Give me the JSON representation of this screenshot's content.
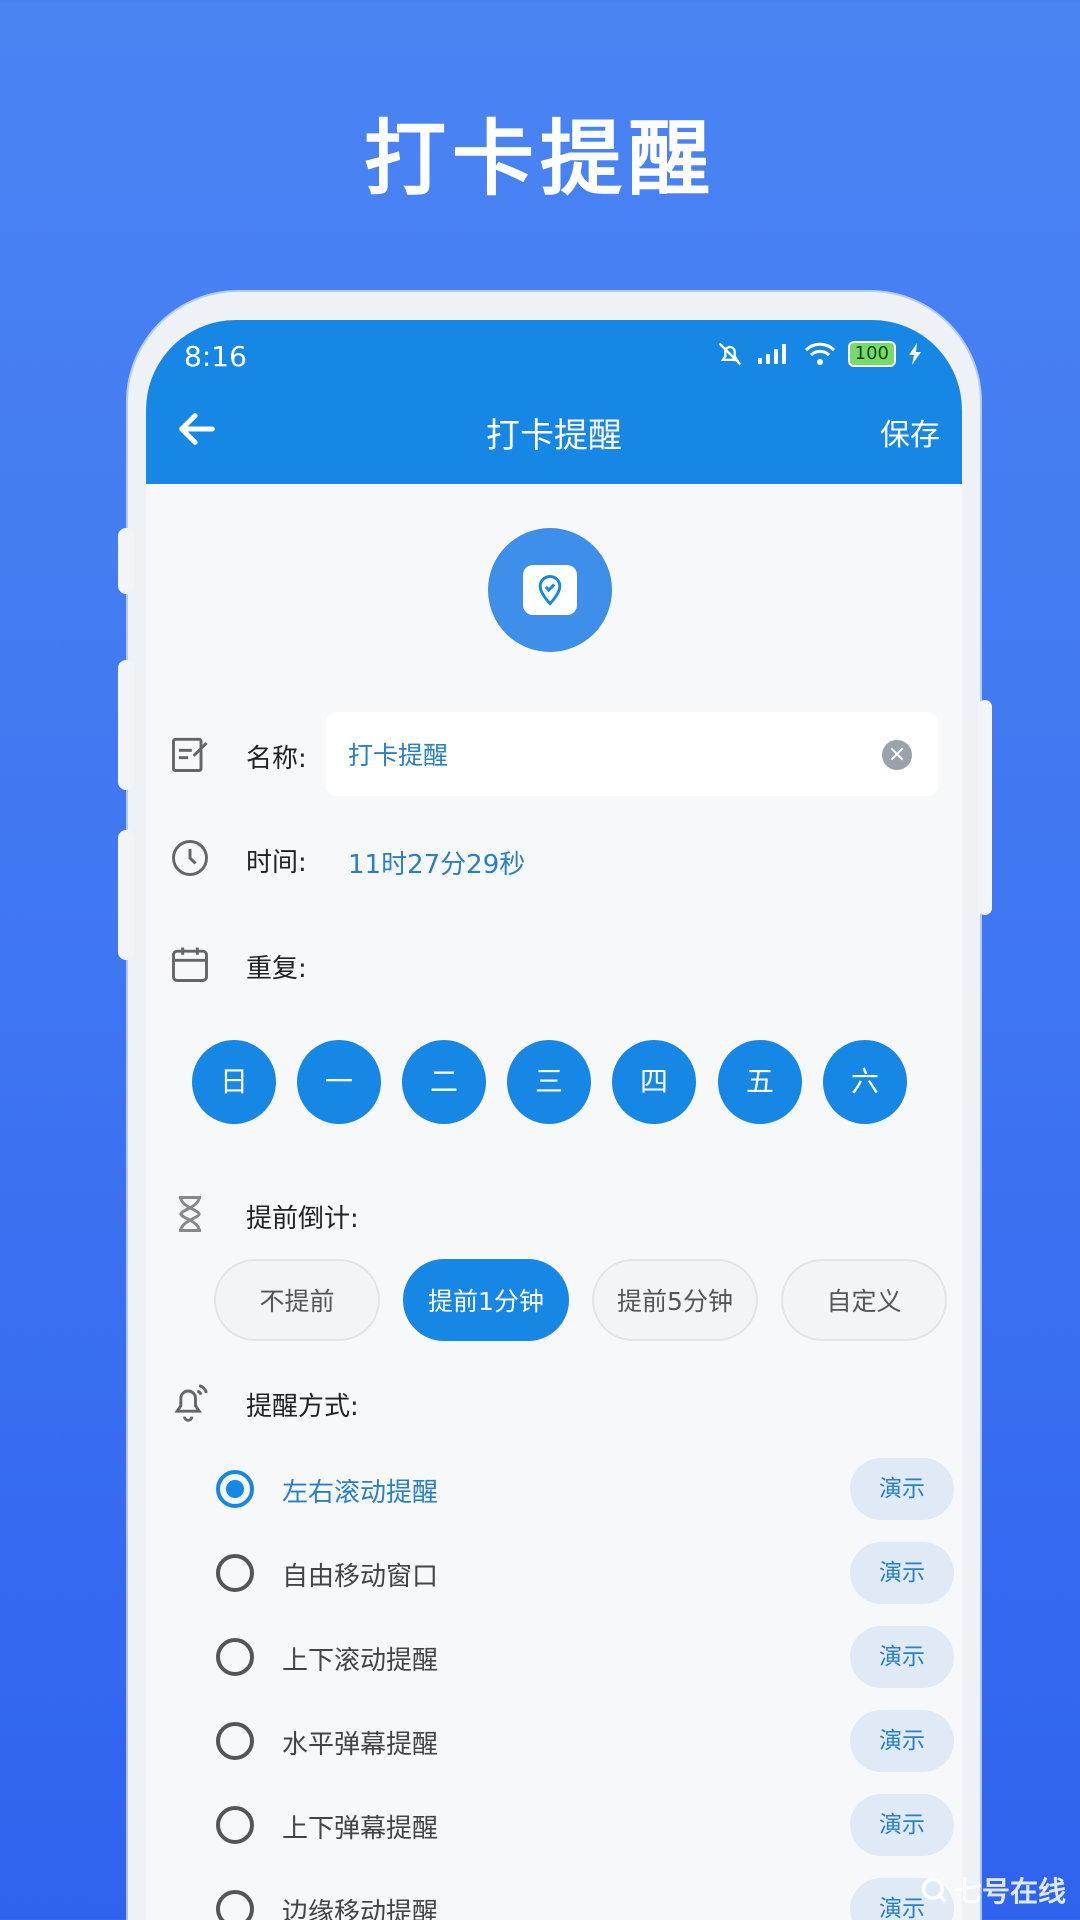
{
  "promo": {
    "title": "打卡提醒"
  },
  "status_bar": {
    "time": "8:16",
    "battery": "100"
  },
  "app_bar": {
    "title": "打卡提醒",
    "save_label": "保存"
  },
  "name_row": {
    "label": "名称:",
    "value": "打卡提醒"
  },
  "time_row": {
    "label": "时间:",
    "value": "11时27分29秒"
  },
  "repeat_row": {
    "label": "重复:",
    "days": [
      "日",
      "一",
      "二",
      "三",
      "四",
      "五",
      "六"
    ]
  },
  "advance_row": {
    "label": "提前倒计:",
    "options": [
      "不提前",
      "提前1分钟",
      "提前5分钟",
      "自定义"
    ],
    "selected": "提前1分钟"
  },
  "method_row": {
    "label": "提醒方式:",
    "demo_label": "演示",
    "options": [
      "左右滚动提醒",
      "自由移动窗口",
      "上下滚动提醒",
      "水平弹幕提醒",
      "上下弹幕提醒",
      "边缘移动提醒"
    ],
    "selected": "左右滚动提醒"
  },
  "watermark": {
    "text": "七号在线"
  },
  "colors": {
    "primary": "#1787e6",
    "accent_text": "#2a7fc9",
    "background": "#4a84f3"
  }
}
